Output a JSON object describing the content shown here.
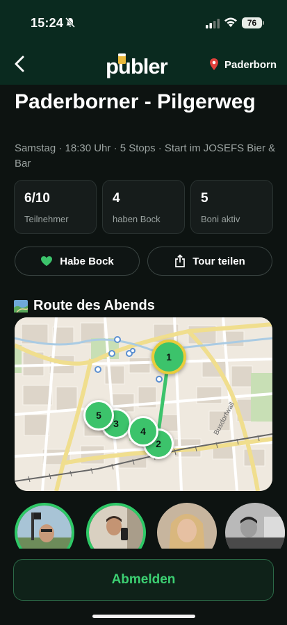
{
  "status_bar": {
    "time": "15:24",
    "battery": "76"
  },
  "nav": {
    "logo": "publer",
    "location": "Paderborn"
  },
  "tour": {
    "title": "Paderborner - Pilgerweg",
    "subtitle": "Samstag · 18:30 Uhr · 5 Stops · Start im JOSEFS Bier & Bar"
  },
  "stats": [
    {
      "value": "6/10",
      "label": "Teilnehmer"
    },
    {
      "value": "4",
      "label": "haben Bock"
    },
    {
      "value": "5",
      "label": "Boni aktiv"
    }
  ],
  "actions": {
    "bock_label": "Habe Bock",
    "share_label": "Tour teilen"
  },
  "route": {
    "title": "Route des Abends",
    "street_label": "Busdorfwall",
    "stops": [
      "1",
      "2",
      "3",
      "4",
      "5"
    ]
  },
  "participants": [
    {
      "name": "avatar-1",
      "highlighted": true
    },
    {
      "name": "avatar-2",
      "highlighted": true
    },
    {
      "name": "avatar-3",
      "highlighted": false
    },
    {
      "name": "avatar-4",
      "highlighted": false
    }
  ],
  "cta": {
    "label": "Abmelden"
  },
  "colors": {
    "accent": "#3cc36b",
    "primary_marker_ring": "#e9cc3b",
    "header_bg": "#0a2a1f",
    "bg": "#0d1311"
  }
}
